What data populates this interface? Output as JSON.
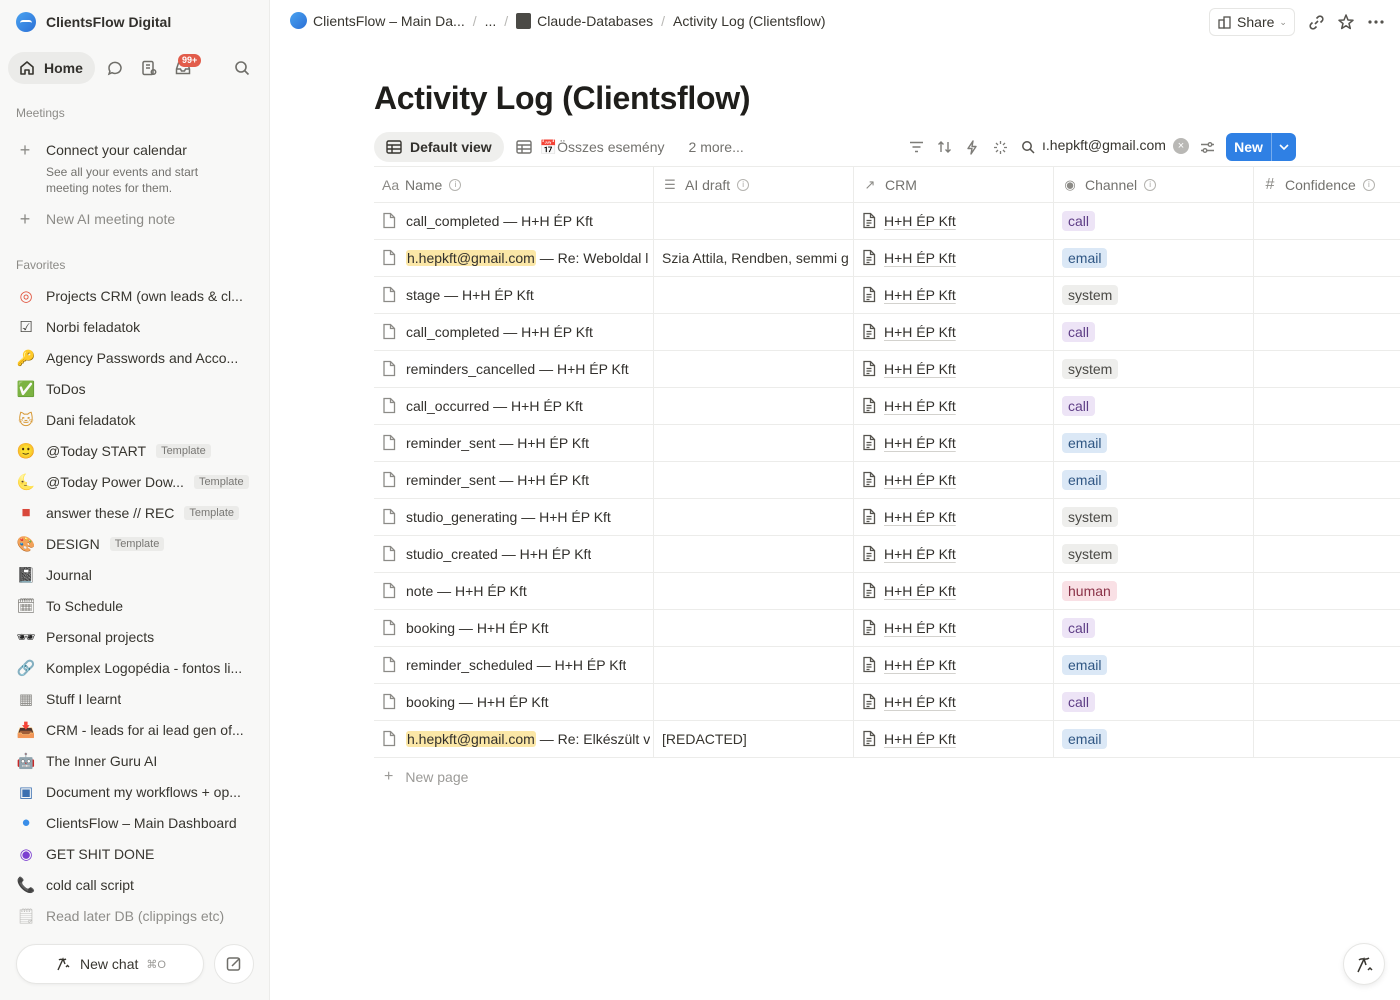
{
  "workspace": {
    "name": "ClientsFlow Digital"
  },
  "nav": {
    "home_label": "Home",
    "inbox_badge": "99+"
  },
  "meetings": {
    "section_label": "Meetings",
    "connect_title": "Connect your calendar",
    "connect_sub": "See all your events and start meeting notes for them.",
    "new_ai_note": "New AI meeting note"
  },
  "favorites": {
    "section_label": "Favorites",
    "items": [
      {
        "label": "Projects CRM (own leads & cl...",
        "icon": "target-icon",
        "glyph": "◎",
        "color": "#e0533d",
        "tag": ""
      },
      {
        "label": "Norbi feladatok",
        "icon": "checkbox-icon",
        "glyph": "☑",
        "color": "#4a4945",
        "tag": ""
      },
      {
        "label": "Agency Passwords and Acco...",
        "icon": "key-icon",
        "glyph": "🔑",
        "color": "#c98a1b",
        "tag": ""
      },
      {
        "label": "ToDos",
        "icon": "check-mark-icon",
        "glyph": "✅",
        "color": "#2ea44f",
        "tag": ""
      },
      {
        "label": "Dani feladatok",
        "icon": "cat-face-icon",
        "glyph": "🐱",
        "color": "#d89b3a",
        "tag": ""
      },
      {
        "label": "@Today START",
        "icon": "smiley-icon",
        "glyph": "🙂",
        "color": "#e3b32b",
        "tag": "Template"
      },
      {
        "label": "@Today Power Dow...",
        "icon": "moon-icon",
        "glyph": "🌜",
        "color": "#e3b32b",
        "tag": "Template"
      },
      {
        "label": "answer these // REC",
        "icon": "video-camera-icon",
        "glyph": "■",
        "color": "#d9483b",
        "tag": "Template"
      },
      {
        "label": "DESIGN",
        "icon": "palette-icon",
        "glyph": "🎨",
        "color": "#c97c3b",
        "tag": "Template"
      },
      {
        "label": "Journal",
        "icon": "notebook-icon",
        "glyph": "📓",
        "color": "#3a3a3a",
        "tag": ""
      },
      {
        "label": "To Schedule",
        "icon": "spiral-calendar-icon",
        "glyph": "🗓",
        "color": "#6f6e69",
        "tag": ""
      },
      {
        "label": "Personal projects",
        "icon": "sunglasses-icon",
        "glyph": "🕶",
        "color": "#222",
        "tag": ""
      },
      {
        "label": "Komplex Logopédia - fontos li...",
        "icon": "link-icon",
        "glyph": "🔗",
        "color": "#c2417a",
        "tag": ""
      },
      {
        "label": "Stuff I learnt",
        "icon": "table-icon",
        "glyph": "▦",
        "color": "#8c8b87",
        "tag": ""
      },
      {
        "label": "CRM - leads for ai lead gen of...",
        "icon": "inbox-tray-icon",
        "glyph": "📥",
        "color": "#6f6e69",
        "tag": ""
      },
      {
        "label": "The Inner Guru AI",
        "icon": "robot-icon",
        "glyph": "🤖",
        "color": "#4a7fb0",
        "tag": ""
      },
      {
        "label": "Document my workflows + op...",
        "icon": "chip-icon",
        "glyph": "▣",
        "color": "#3b6fb0",
        "tag": ""
      },
      {
        "label": "ClientsFlow – Main Dashboard",
        "icon": "clientsflow-logo-icon",
        "glyph": "●",
        "color": "#3a8ee8",
        "tag": ""
      },
      {
        "label": "GET SHIT DONE",
        "icon": "purple-emblem-icon",
        "glyph": "◉",
        "color": "#7b3fd0",
        "tag": ""
      },
      {
        "label": "cold call script",
        "icon": "phone-icon",
        "glyph": "📞",
        "color": "#2ea44f",
        "tag": ""
      },
      {
        "label": "Read later DB (clippings etc)",
        "icon": "spiral-notepad-icon",
        "glyph": "🗒",
        "color": "#8c8b87",
        "tag": ""
      }
    ]
  },
  "bottom": {
    "new_chat": "New chat",
    "new_chat_shortcut": "⌘O"
  },
  "breadcrumb": {
    "items": [
      "ClientsFlow – Main Da...",
      "...",
      "Claude-Databases",
      "Activity Log (Clientsflow)"
    ]
  },
  "topbar": {
    "share_label": "Share"
  },
  "page": {
    "title": "Activity Log (Clientsflow)"
  },
  "views": {
    "default_label": "Default view",
    "second_label": "📅Összes esemény",
    "more_label": "2 more..."
  },
  "search": {
    "value": "ı.hepkft@gmail.com"
  },
  "new_button": {
    "label": "New"
  },
  "table": {
    "columns": [
      "Name",
      "AI draft",
      "CRM",
      "Channel",
      "Confidence"
    ],
    "rows": [
      {
        "prefix": "",
        "name": "call_completed — H+H ÉP Kft",
        "ai_draft": "",
        "crm": "H+H ÉP Kft",
        "channel": "call"
      },
      {
        "prefix": "h.hepkft@gmail.com",
        "name": " — Re: Weboldal l",
        "ai_draft": "Szia Attila, Rendben, semmi g",
        "crm": "H+H ÉP Kft",
        "channel": "email"
      },
      {
        "prefix": "",
        "name": "stage — H+H ÉP Kft",
        "ai_draft": "",
        "crm": "H+H ÉP Kft",
        "channel": "system"
      },
      {
        "prefix": "",
        "name": "call_completed — H+H ÉP Kft",
        "ai_draft": "",
        "crm": "H+H ÉP Kft",
        "channel": "call"
      },
      {
        "prefix": "",
        "name": "reminders_cancelled — H+H ÉP Kft",
        "ai_draft": "",
        "crm": "H+H ÉP Kft",
        "channel": "system"
      },
      {
        "prefix": "",
        "name": "call_occurred — H+H ÉP Kft",
        "ai_draft": "",
        "crm": "H+H ÉP Kft",
        "channel": "call"
      },
      {
        "prefix": "",
        "name": "reminder_sent — H+H ÉP Kft",
        "ai_draft": "",
        "crm": "H+H ÉP Kft",
        "channel": "email"
      },
      {
        "prefix": "",
        "name": "reminder_sent — H+H ÉP Kft",
        "ai_draft": "",
        "crm": "H+H ÉP Kft",
        "channel": "email"
      },
      {
        "prefix": "",
        "name": "studio_generating — H+H ÉP Kft",
        "ai_draft": "",
        "crm": "H+H ÉP Kft",
        "channel": "system"
      },
      {
        "prefix": "",
        "name": "studio_created — H+H ÉP Kft",
        "ai_draft": "",
        "crm": "H+H ÉP Kft",
        "channel": "system"
      },
      {
        "prefix": "",
        "name": "note — H+H ÉP Kft",
        "ai_draft": "",
        "crm": "H+H ÉP Kft",
        "channel": "human"
      },
      {
        "prefix": "",
        "name": "booking — H+H ÉP Kft",
        "ai_draft": "",
        "crm": "H+H ÉP Kft",
        "channel": "call"
      },
      {
        "prefix": "",
        "name": "reminder_scheduled — H+H ÉP Kft",
        "ai_draft": "",
        "crm": "H+H ÉP Kft",
        "channel": "email"
      },
      {
        "prefix": "",
        "name": "booking — H+H ÉP Kft",
        "ai_draft": "",
        "crm": "H+H ÉP Kft",
        "channel": "call"
      },
      {
        "prefix": "h.hepkft@gmail.com",
        "name": " — Re: Elkészült v",
        "ai_draft": "[REDACTED]",
        "crm": "H+H ÉP Kft",
        "channel": "email"
      }
    ],
    "new_page_label": "New page"
  }
}
